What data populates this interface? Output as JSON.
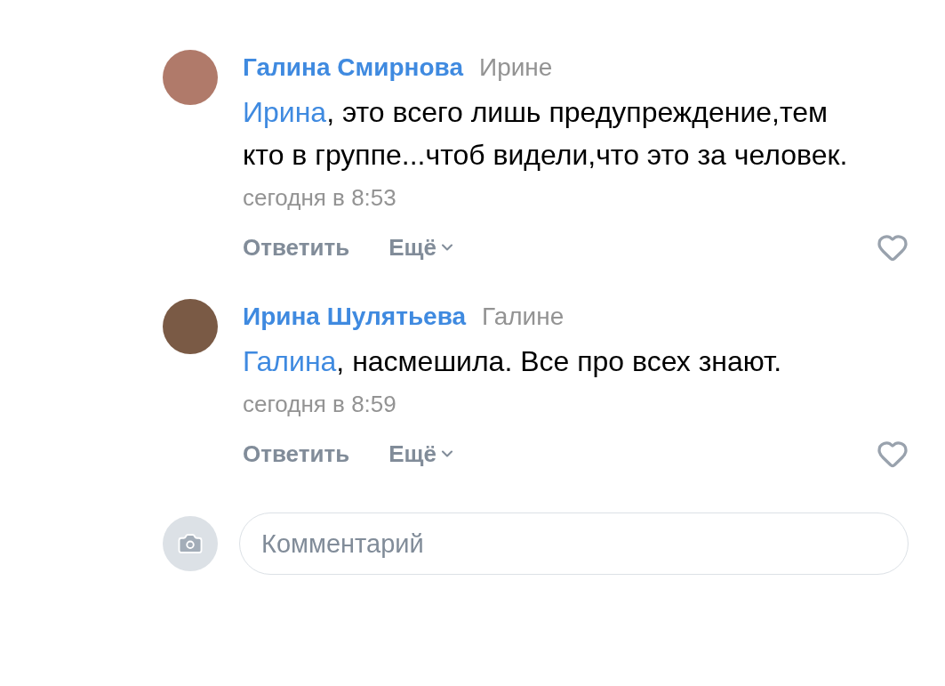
{
  "comments": [
    {
      "author": "Галина Смирнова",
      "reply_to": "Ирине",
      "mention": "Ирина",
      "text": ", это всего лишь предупреждение,тем кто в группе...чтоб видели,что это за человек.",
      "time": "сегодня в 8:53",
      "reply": "Ответить",
      "more": "Ещё",
      "liked": false
    },
    {
      "author": "Ирина Шулятьева",
      "reply_to": "Галине",
      "mention": "Галина",
      "text": ", насмешила. Все про всех знают.",
      "time": "сегодня в 8:59",
      "reply": "Ответить",
      "more": "Ещё",
      "liked": false
    }
  ],
  "composer": {
    "placeholder": "Комментарий"
  }
}
